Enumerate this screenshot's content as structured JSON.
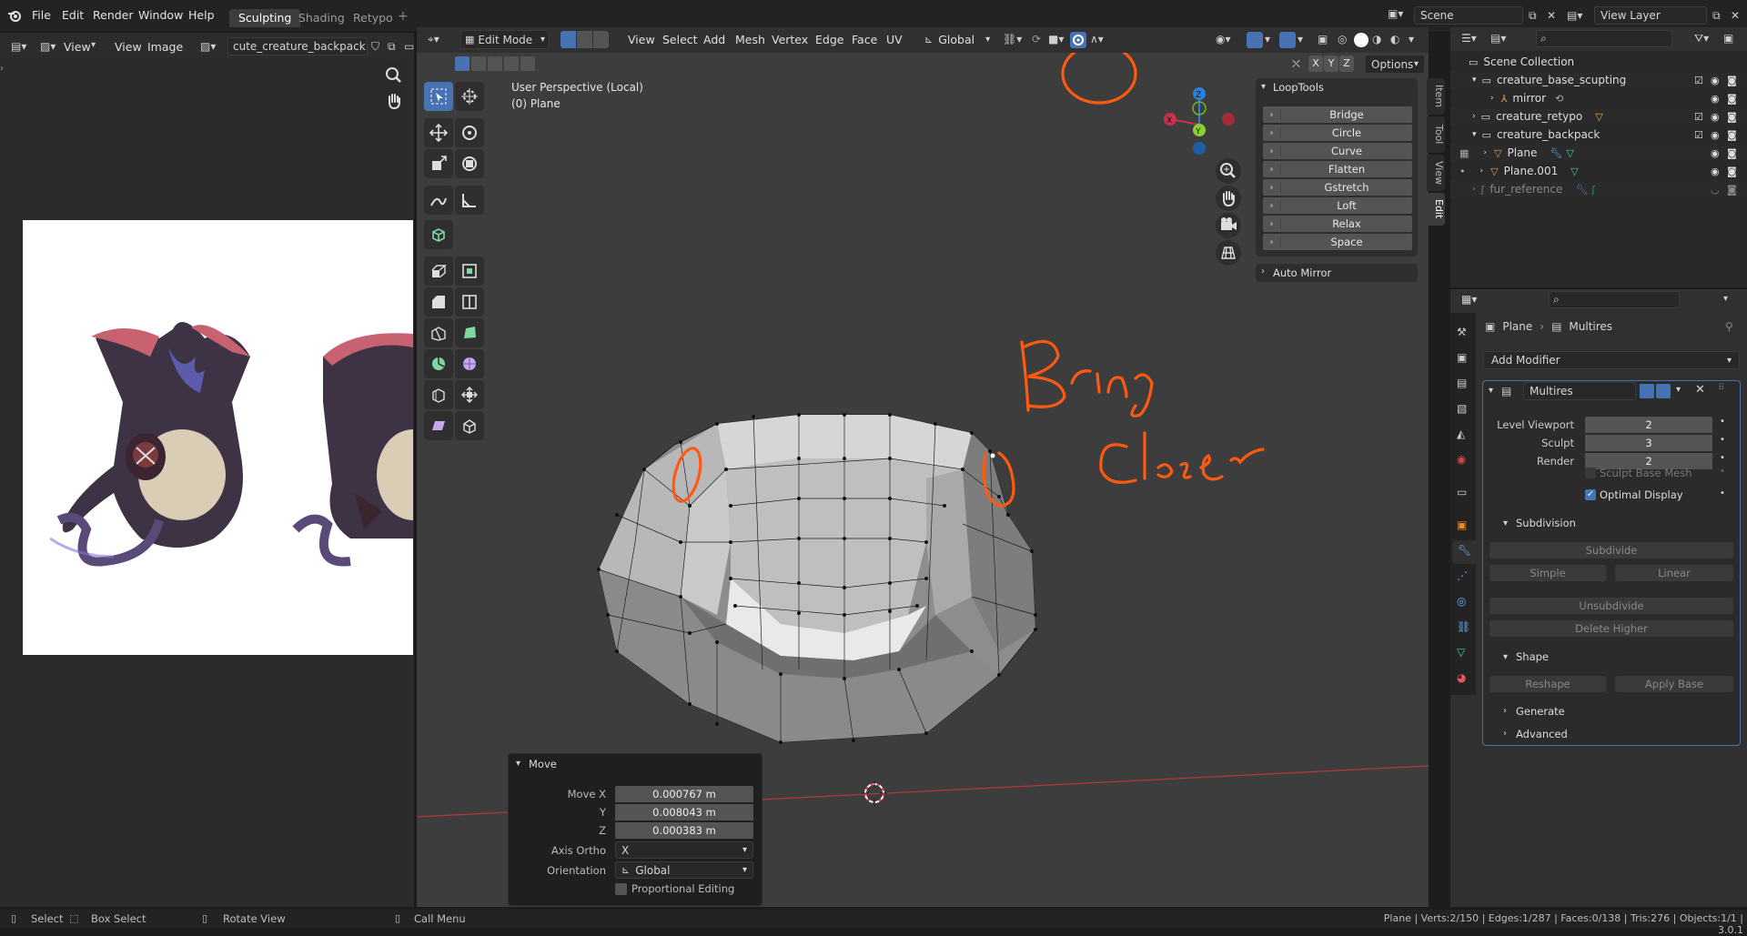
{
  "topbar": {
    "menus": [
      "File",
      "Edit",
      "Render",
      "Window",
      "Help"
    ],
    "workspaces": [
      "Sculpting",
      "Shading",
      "Retypo"
    ],
    "scene": "Scene",
    "view_layer": "View Layer"
  },
  "image_editor": {
    "view": "View",
    "view2": "View",
    "image": "Image",
    "image_name": "cute_creature_backpack.jpg"
  },
  "viewport": {
    "mode": "Edit Mode",
    "menus": [
      "View",
      "Select",
      "Add",
      "Mesh",
      "Vertex",
      "Edge",
      "Face",
      "UV"
    ],
    "orientation": "Global",
    "axes": [
      "X",
      "Y",
      "Z"
    ],
    "options": "Options",
    "perspective": "User Perspective (Local)",
    "object": "(0) Plane",
    "gizmo": {
      "x": "X",
      "y": "Y",
      "z": "Z"
    }
  },
  "side_tabs": [
    "Item",
    "Tool",
    "View",
    "Edit"
  ],
  "looptools": {
    "title": "LoopTools",
    "items": [
      "Bridge",
      "Circle",
      "Curve",
      "Flatten",
      "Gstretch",
      "Loft",
      "Relax",
      "Space"
    ],
    "auto_mirror": "Auto Mirror"
  },
  "move_panel": {
    "title": "Move",
    "move_x_label": "Move X",
    "move_x": "0.000767 m",
    "y_label": "Y",
    "y": "0.008043 m",
    "z_label": "Z",
    "z": "0.000383 m",
    "axis_ortho_label": "Axis Ortho",
    "axis_ortho": "X",
    "orientation_label": "Orientation",
    "orientation": "Global",
    "proportional": "Proportional Editing"
  },
  "annotation": {
    "line1": "Bring",
    "line2": "Closer",
    "color": "#ff5a12"
  },
  "outliner": {
    "root": "Scene Collection",
    "rows": [
      {
        "label": "creature_base_scupting"
      },
      {
        "label": "mirror"
      },
      {
        "label": "creature_retypo"
      },
      {
        "label": "creature_backpack"
      },
      {
        "label": "Plane"
      },
      {
        "label": "Plane.001"
      },
      {
        "label": "fur_reference"
      }
    ]
  },
  "properties": {
    "breadcrumb_obj": "Plane",
    "breadcrumb_mod": "Multires",
    "add_modifier": "Add Modifier",
    "modifier_name": "Multires",
    "level_viewport_label": "Level Viewport",
    "level_viewport": "2",
    "sculpt_label": "Sculpt",
    "sculpt": "3",
    "render_label": "Render",
    "render": "2",
    "sculpt_base_mesh": "Sculpt Base Mesh",
    "optimal_display": "Optimal Display",
    "subdivision": "Subdivision",
    "subdivide": "Subdivide",
    "simple": "Simple",
    "linear": "Linear",
    "unsubdivide": "Unsubdivide",
    "delete_higher": "Delete Higher",
    "shape": "Shape",
    "reshape": "Reshape",
    "apply_base": "Apply Base",
    "generate": "Generate",
    "advanced": "Advanced"
  },
  "status": {
    "select": "Select",
    "box_select": "Box Select",
    "rotate_view": "Rotate View",
    "call_menu": "Call Menu",
    "stats": "Plane | Verts:2/150 | Edges:1/287 | Faces:0/138 | Tris:276 | Objects:1/1 | 3.0.1"
  }
}
